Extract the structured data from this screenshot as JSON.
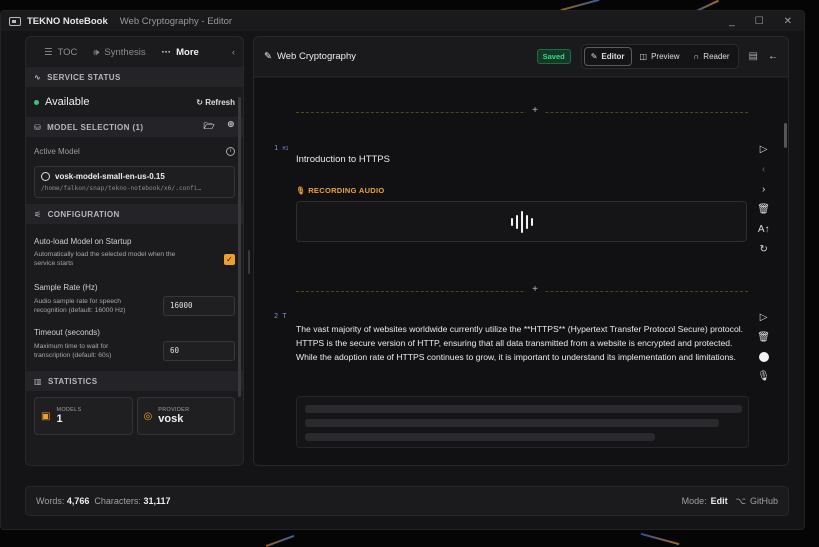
{
  "titlebar": {
    "app_name": "TEKNO NoteBook",
    "window_title": "Web Cryptography - Editor",
    "minimize": "_",
    "maximize": "☐",
    "close": "✕"
  },
  "left_tabs": [
    {
      "label": "TOC"
    },
    {
      "label": "Synthesis"
    },
    {
      "label": "More"
    }
  ],
  "service": {
    "header": "SERVICE STATUS",
    "status": "Available",
    "refresh_label": "Refresh"
  },
  "model_selection": {
    "header": "MODEL SELECTION (1)",
    "active_model_label": "Active Model",
    "model_name": "vosk-model-small-en-us-0.15",
    "model_path": "/home/falkon/snap/tekno-notebook/x6/.confi…"
  },
  "configuration": {
    "header": "CONFIGURATION",
    "auto_load_title": "Auto-load Model on Startup",
    "auto_load_desc": "Automatically load the selected model when the service starts",
    "auto_load_checked": true,
    "sample_rate_title": "Sample Rate (Hz)",
    "sample_rate_desc": "Audio sample rate for speech recognition (default: 16000 Hz)",
    "sample_rate_value": "16000",
    "timeout_title": "Timeout (seconds)",
    "timeout_desc": "Maximum time to wait for transcription (default: 60s)",
    "timeout_value": "60"
  },
  "statistics": {
    "header": "STATISTICS",
    "models_label": "MODELS",
    "models_value": "1",
    "provider_label": "PROVIDER",
    "provider_value": "vosk"
  },
  "editor": {
    "doc_title": "Web Cryptography",
    "saved_label": "Saved",
    "modes": [
      {
        "label": "Editor"
      },
      {
        "label": "Preview"
      },
      {
        "label": "Reader"
      }
    ],
    "block1": {
      "num": "1",
      "tag": "H1",
      "text": "Introduction to HTTPS",
      "recording_label": "RECORDING AUDIO"
    },
    "block2": {
      "num": "2",
      "tag": "T",
      "text": "The vast majority of websites worldwide currently utilize the **HTTPS** (Hypertext Transfer Protocol Secure) protocol. HTTPS is the secure version of HTTP, ensuring that all data transmitted from a website is encrypted and protected. While the adoption rate of HTTPS continues to grow, it is important to understand its implementation and limitations."
    },
    "add_block": "+"
  },
  "footer": {
    "words_label": "Words:",
    "words_value": "4,766",
    "chars_label": "Characters:",
    "chars_value": "31,117",
    "mode_label": "Mode:",
    "mode_value": "Edit",
    "github_label": "GitHub"
  },
  "colors": {
    "accent": "#f0a024",
    "saved_green": "#3fd58a",
    "available_dot": "#37c77a"
  }
}
